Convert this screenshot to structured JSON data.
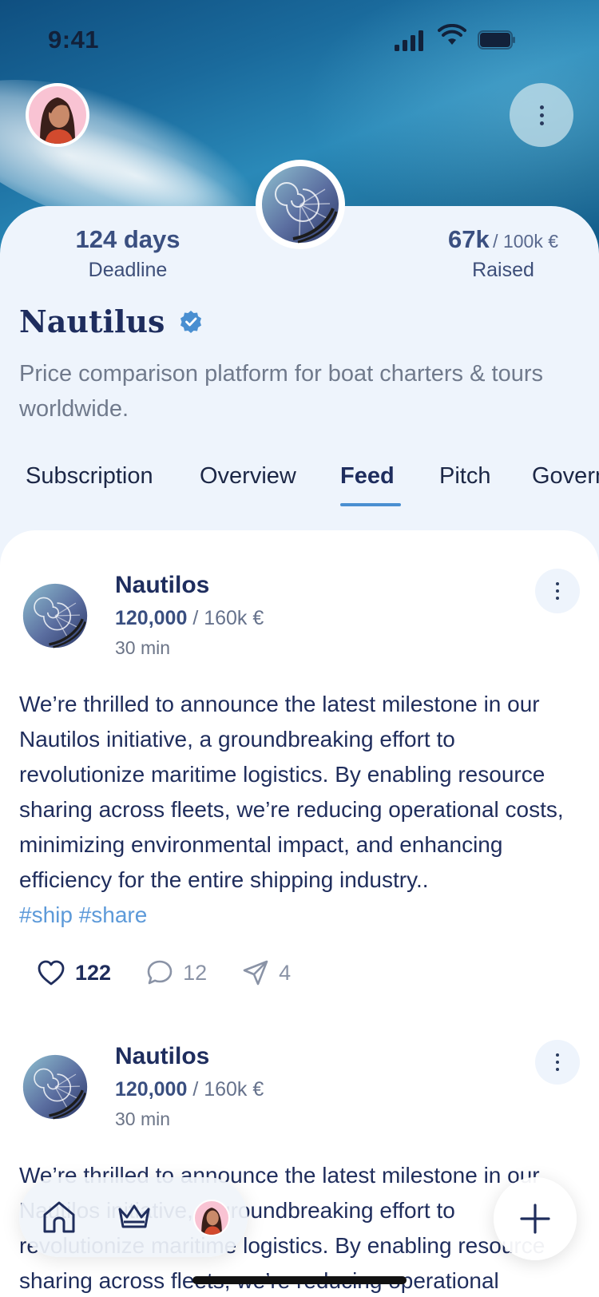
{
  "status_bar": {
    "time": "9:41"
  },
  "project": {
    "name": "Nautilus",
    "verified": true,
    "description": "Price comparison platform for boat charters & tours worldwide.",
    "stats": {
      "deadline_value": "124 days",
      "deadline_label": "Deadline",
      "raised_value": "67k",
      "raised_total": "/ 100k €",
      "raised_label": "Raised"
    }
  },
  "tabs": [
    {
      "label": "Subscription",
      "active": false
    },
    {
      "label": "Overview",
      "active": false
    },
    {
      "label": "Feed",
      "active": true
    },
    {
      "label": "Pitch",
      "active": false
    },
    {
      "label": "Govern",
      "active": false
    }
  ],
  "posts": [
    {
      "author": "Nautilos",
      "amount": "120,000",
      "goal": "/ 160k €",
      "time": "30 min",
      "body": "We’re thrilled to announce the latest milestone in our Nautilos initiative, a groundbreaking effort to revolutionize maritime logistics. By enabling resource sharing across fleets, we’re reducing operational costs, minimizing environmental impact, and enhancing efficiency for the entire shipping industry..",
      "tags": "#ship #share",
      "likes": "122",
      "comments": "12",
      "shares": "4"
    },
    {
      "author": "Nautilos",
      "amount": "120,000",
      "goal": "/ 160k €",
      "time": "30 min",
      "body": "We’re thrilled to announce the latest milestone in our Nautilos initiative, a groundbreaking effort to revolutionize maritime logistics. By enabling resource sharing across fleets, we’re reducing operational"
    }
  ],
  "colors": {
    "accent": "#4a8fd1",
    "title": "#1e2d5e",
    "tag": "#5d9ad9"
  },
  "icons": [
    "signal-icon",
    "wifi-icon",
    "battery-icon",
    "more-icon",
    "verified-icon",
    "heart-icon",
    "comment-icon",
    "send-icon",
    "home-icon",
    "crown-icon",
    "plus-icon"
  ]
}
